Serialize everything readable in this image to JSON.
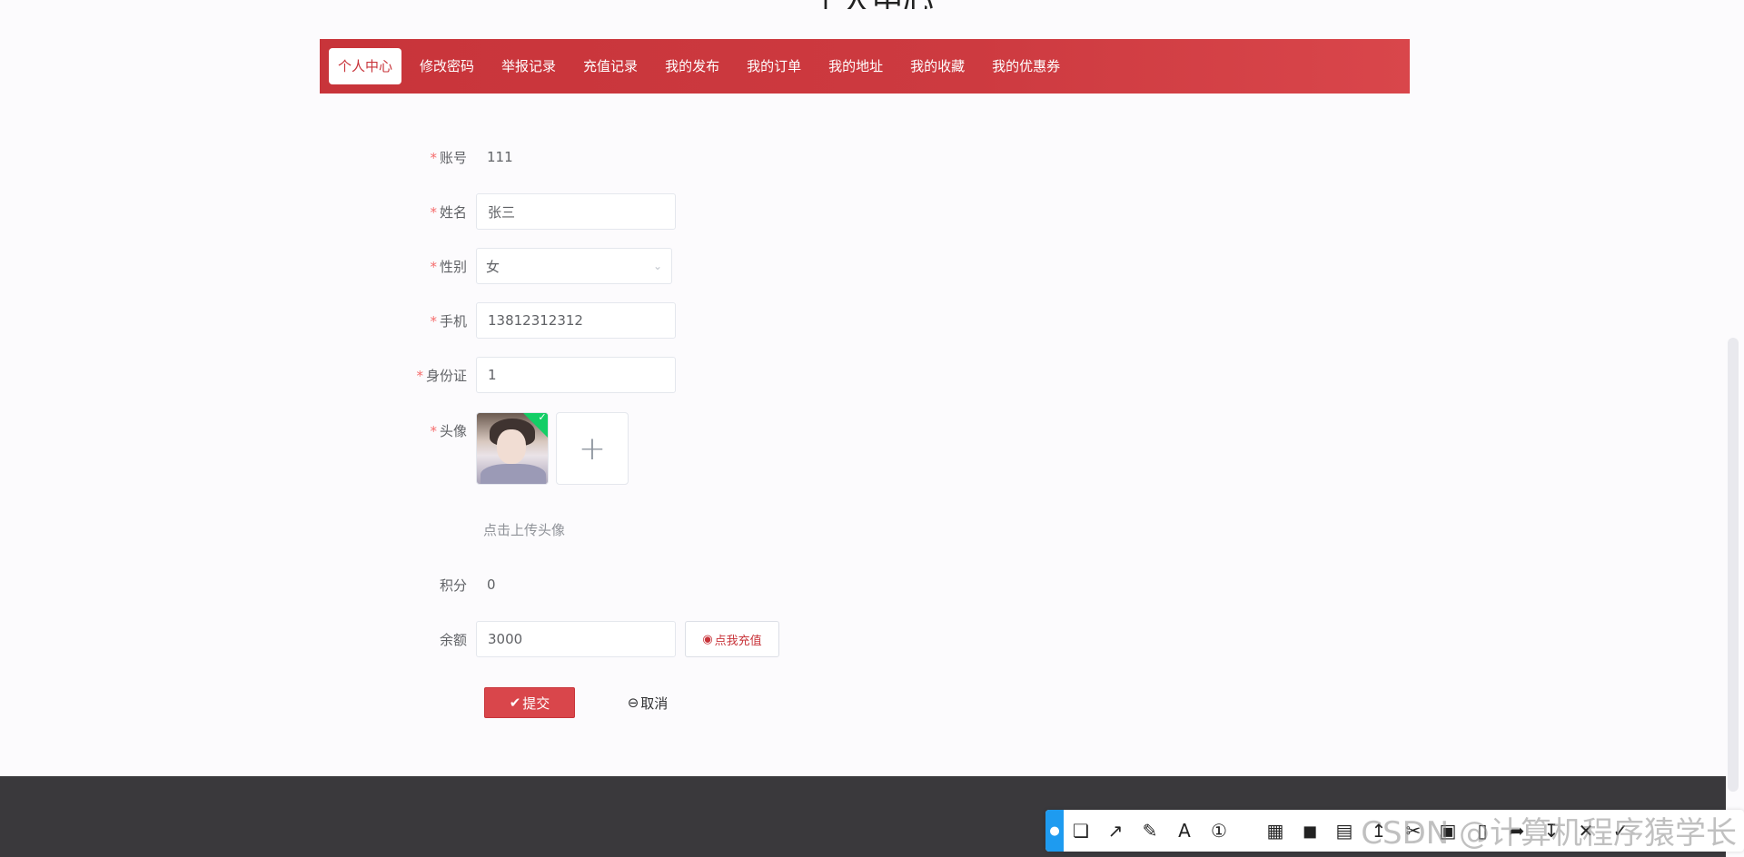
{
  "page": {
    "title": "个人中心"
  },
  "tabs": [
    {
      "label": "个人中心",
      "active": true
    },
    {
      "label": "修改密码"
    },
    {
      "label": "举报记录"
    },
    {
      "label": "充值记录"
    },
    {
      "label": "我的发布"
    },
    {
      "label": "我的订单"
    },
    {
      "label": "我的地址"
    },
    {
      "label": "我的收藏"
    },
    {
      "label": "我的优惠券"
    }
  ],
  "form": {
    "required_mark": "*",
    "account": {
      "label": "账号",
      "value": "111"
    },
    "name": {
      "label": "姓名",
      "value": "张三"
    },
    "gender": {
      "label": "性别",
      "value": "女"
    },
    "phone": {
      "label": "手机",
      "value": "13812312312"
    },
    "id_card": {
      "label": "身份证",
      "value": "1"
    },
    "avatar": {
      "label": "头像",
      "upload_icon": "+",
      "hint": "点击上传头像"
    },
    "points": {
      "label": "积分",
      "value": "0"
    },
    "balance": {
      "label": "余额",
      "value": "3000",
      "recharge_label": "点我充值"
    },
    "submit_label": "提交",
    "cancel_label": "取消"
  },
  "overlay": {
    "watermark": "CSDN @计算机程序猿学长",
    "icons": [
      "bell-icon",
      "shape-icon",
      "arrow-icon",
      "pen-icon",
      "text-icon",
      "number-icon",
      "mosaic-icon",
      "blur-icon",
      "highlight-icon",
      "pin-icon",
      "scissors-icon",
      "ocr-icon",
      "long-screenshot-icon",
      "share-icon",
      "download-icon",
      "close-icon",
      "confirm-icon"
    ]
  },
  "colors": {
    "brand": "#c8343a",
    "footer": "#3a393c",
    "required": "#f56c6c",
    "success": "#13ce66"
  }
}
